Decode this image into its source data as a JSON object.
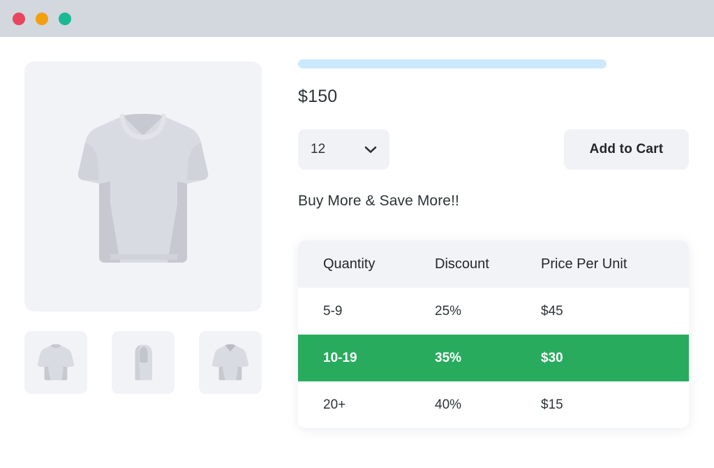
{
  "titlebar": {
    "buttons": [
      {
        "name": "close-button",
        "color": "#e8455f"
      },
      {
        "name": "minimize-button",
        "color": "#f2a00f"
      },
      {
        "name": "maximize-button",
        "color": "#1bb894"
      }
    ]
  },
  "gallery": {
    "hero_alt": "tshirt-front",
    "thumbnails": [
      {
        "alt": "tshirt-back-thumbnail"
      },
      {
        "alt": "tshirt-side-thumbnail"
      },
      {
        "alt": "tshirt-front-thumbnail"
      }
    ]
  },
  "product": {
    "title_placeholder": "",
    "price": "$150",
    "quantity_value": "12",
    "quantity_options": [
      "12"
    ],
    "add_to_cart_label": "Add to Cart",
    "promo_heading": "Buy More & Save More!!"
  },
  "pricing_table": {
    "headers": {
      "quantity": "Quantity",
      "discount": "Discount",
      "price_per_unit": "Price Per Unit"
    },
    "rows": [
      {
        "quantity": "5-9",
        "discount": "25%",
        "price": "$45",
        "highlighted": false
      },
      {
        "quantity": "10-19",
        "discount": "35%",
        "price": "$30",
        "highlighted": true
      },
      {
        "quantity": "20+",
        "discount": "40%",
        "price": "$15",
        "highlighted": false
      }
    ]
  },
  "colors": {
    "titlebar": "#d3d7de",
    "highlight_green": "#29ab5e",
    "skeleton_blue": "#cbe8fd",
    "surface_gray": "#f2f3f7"
  }
}
